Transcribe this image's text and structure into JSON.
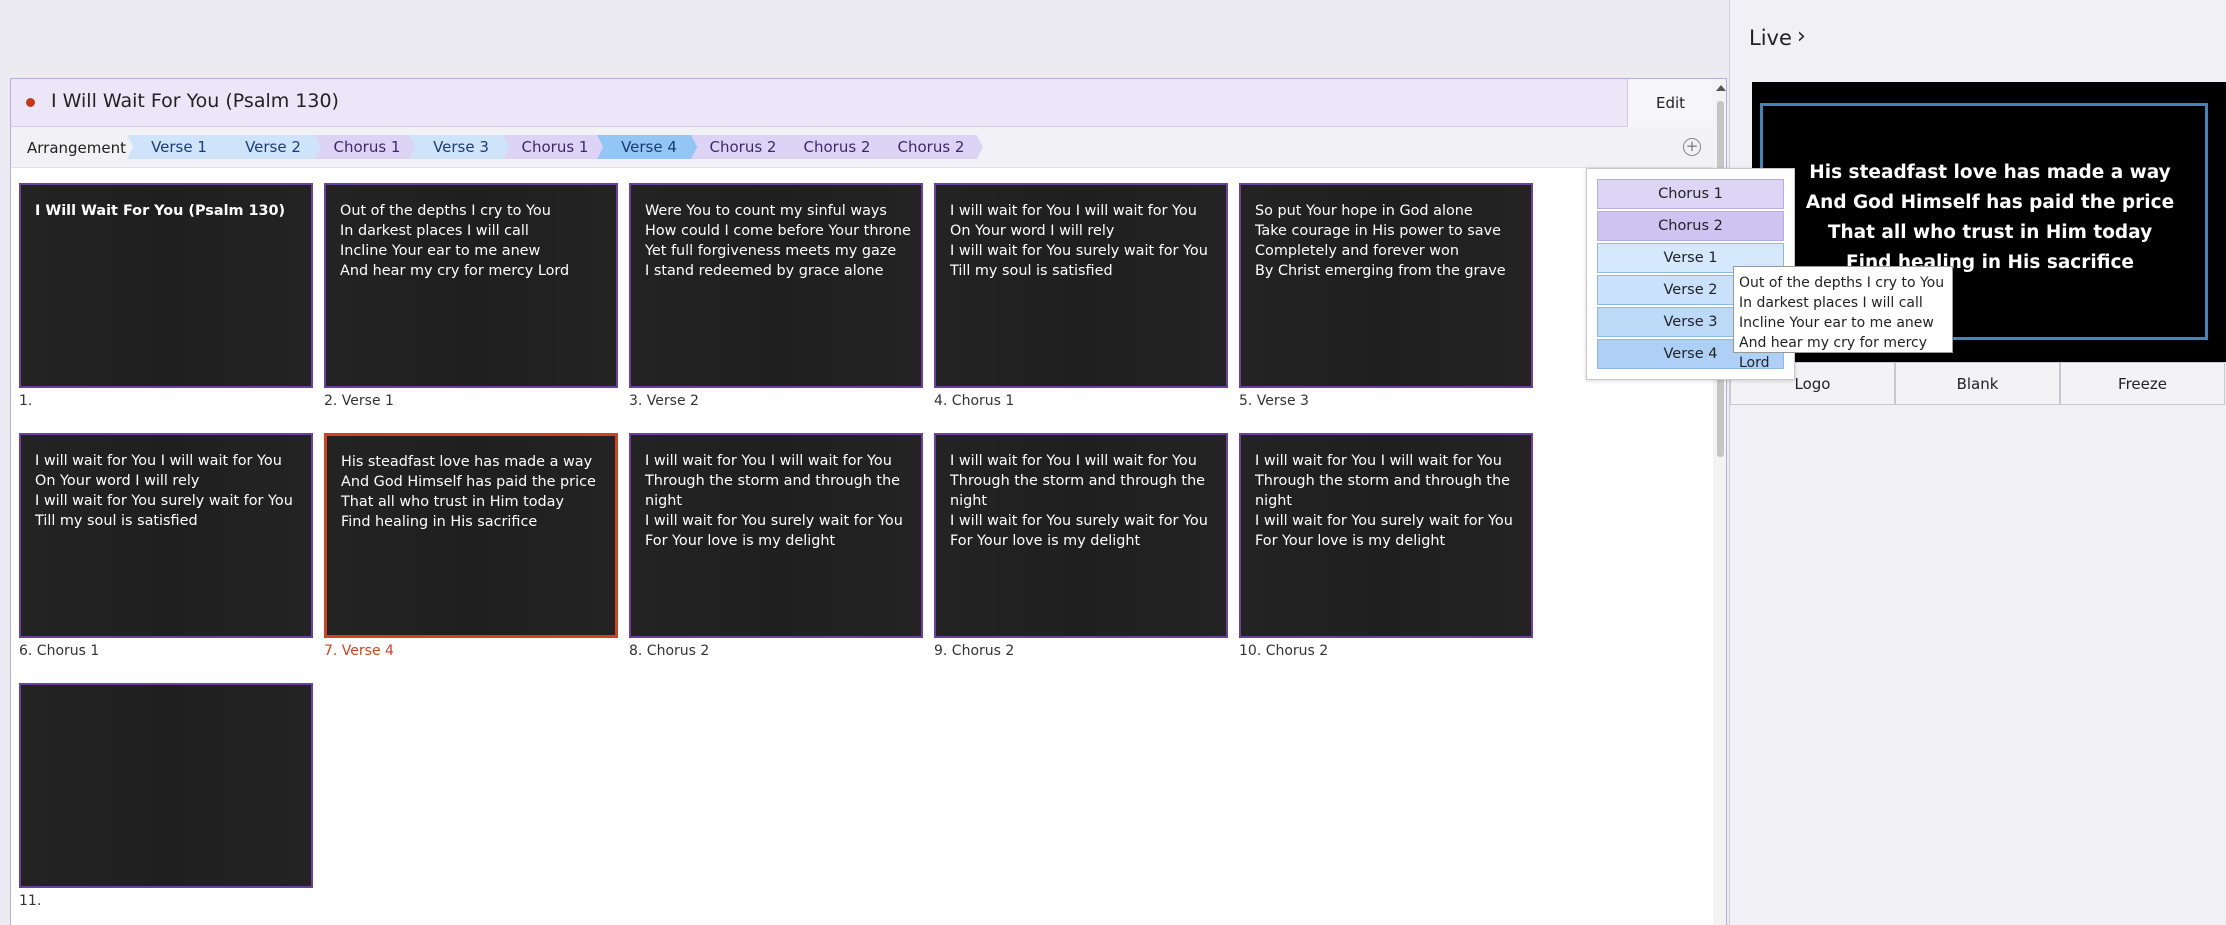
{
  "song": {
    "title": "I Will Wait For You (Psalm 130)",
    "edit_label": "Edit",
    "arrangement_label": "Arrangement",
    "arrangement": [
      {
        "label": "Verse 1",
        "kind": "verse"
      },
      {
        "label": "Verse 2",
        "kind": "verse"
      },
      {
        "label": "Chorus 1",
        "kind": "chorus"
      },
      {
        "label": "Verse 3",
        "kind": "verse"
      },
      {
        "label": "Chorus 1",
        "kind": "chorus"
      },
      {
        "label": "Verse 4",
        "kind": "active-verse"
      },
      {
        "label": "Chorus 2",
        "kind": "chorus"
      },
      {
        "label": "Chorus 2",
        "kind": "chorus"
      },
      {
        "label": "Chorus 2",
        "kind": "chorus"
      }
    ],
    "add_icon": "plus-circle-icon",
    "accent_color": "#cf4322",
    "slide_border_color": "#6c3fa1"
  },
  "slides": [
    {
      "caption": "1.",
      "text": "I Will Wait For You (Psalm 130)",
      "bold": true
    },
    {
      "caption": "2. Verse 1",
      "text": "Out of the depths I cry to You\nIn darkest places I will call\nIncline Your ear to me anew\nAnd hear my cry for mercy Lord"
    },
    {
      "caption": "3. Verse 2",
      "text": "Were You to count my sinful ways\nHow could I come before Your throne\nYet full forgiveness meets my gaze\nI stand redeemed by grace alone"
    },
    {
      "caption": "4. Chorus 1",
      "text": "I will wait for You I will wait for You\nOn Your word I will rely\nI will wait for You surely wait for You\nTill my soul is satisfied"
    },
    {
      "caption": "5. Verse 3",
      "text": "So put Your hope in God alone\nTake courage in His power to save\nCompletely and forever won\nBy Christ emerging from the grave"
    },
    {
      "caption": "6. Chorus 1",
      "text": "I will wait for You I will wait for You\nOn Your word I will rely\nI will wait for You surely wait for You\nTill my soul is satisfied"
    },
    {
      "caption": "7. Verse 4",
      "text": "His steadfast love has made a way\nAnd God Himself has paid the price\nThat all who trust in Him today\nFind healing in His sacrifice",
      "selected": true
    },
    {
      "caption": "8. Chorus 2",
      "text": "I will wait for You I will wait for You\nThrough the storm and through the\nnight\nI will wait for You surely wait for You\nFor Your love is my delight"
    },
    {
      "caption": "9. Chorus 2",
      "text": "I will wait for You I will wait for You\nThrough the storm and through the\nnight\nI will wait for You surely wait for You\nFor Your love is my delight"
    },
    {
      "caption": "10. Chorus 2",
      "text": "I will wait for You I will wait for You\nThrough the storm and through the\nnight\nI will wait for You surely wait for You\nFor Your love is my delight"
    },
    {
      "caption": "11.",
      "text": ""
    }
  ],
  "popup": {
    "items": [
      {
        "label": "Chorus 1",
        "color": "#ddd4f6"
      },
      {
        "label": "Chorus 2",
        "color": "#cfc3f2"
      },
      {
        "label": "Verse 1",
        "color": "#d6e8fb"
      },
      {
        "label": "Verse 2",
        "color": "#c9e1fa"
      },
      {
        "label": "Verse 3",
        "color": "#bdd9f8"
      },
      {
        "label": "Verse 4",
        "color": "#aed0f7"
      }
    ],
    "tooltip": "Out of the depths I cry to You\nIn darkest places I will call\nIncline Your ear to me anew\nAnd hear my cry for mercy Lord"
  },
  "live": {
    "title": "Live",
    "chevron_icon": "chevron-right-icon",
    "text": "His steadfast love has made a way\nAnd God Himself has paid the price\nThat all who trust in Him today\nFind healing in His sacrifice",
    "frame_color": "#3f86c1",
    "buttons": [
      "Logo",
      "Blank",
      "Freeze"
    ]
  }
}
